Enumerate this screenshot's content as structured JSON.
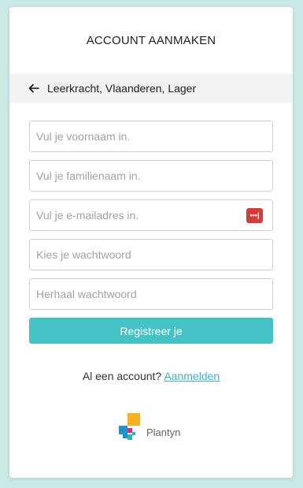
{
  "header": {
    "title": "ACCOUNT AANMAKEN"
  },
  "context": {
    "label": "Leerkracht, Vlaanderen, Lager",
    "back_icon": "arrow-left-icon"
  },
  "form": {
    "first_name": {
      "placeholder": "Vul je voornaam in.",
      "value": ""
    },
    "last_name": {
      "placeholder": "Vul je familienaam in.",
      "value": ""
    },
    "email": {
      "placeholder": "Vul je e-mailadres in.",
      "value": "",
      "manager_icon": "password-manager-icon",
      "manager_label": "•••|"
    },
    "password": {
      "placeholder": "Kies je wachtwoord",
      "value": ""
    },
    "password_repeat": {
      "placeholder": "Herhaal wachtwoord",
      "value": ""
    },
    "submit_label": "Registreer je"
  },
  "login": {
    "prompt": "Al een account?",
    "link_label": "Aanmelden"
  },
  "brand": {
    "name": "Plantyn",
    "colors": {
      "accent": "#45c3c4",
      "link": "#3fb3c4",
      "background": "#c9e9e6",
      "logo_yellow": "#f5b323",
      "logo_blue": "#1a93cf",
      "logo_pink": "#e5247f",
      "logo_teal": "#2ab7b1"
    }
  }
}
